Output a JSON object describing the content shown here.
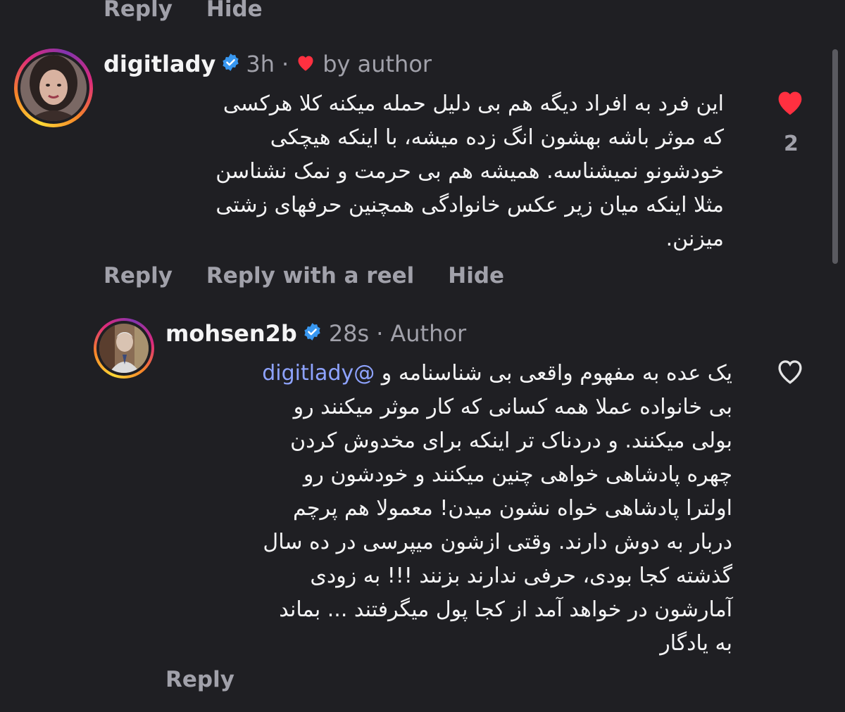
{
  "top_actions": {
    "reply": "Reply",
    "hide": "Hide"
  },
  "comment1": {
    "username": "digitlady",
    "time": "3h",
    "separator": "·",
    "liked_by": "by author",
    "text": "این فرد به افراد دیگه هم بی دلیل حمله میکنه کلا هرکسی\nکه موثر باشه بهشون انگ زده میشه، با اینکه هیچکی\nخودشونو نمیشناسه. همیشه هم بی حرمت و نمک نشناسن\nمثلا اینکه میان زیر عکس خانوادگی همچنین حرفهای زشتی\nمیزنن.",
    "like_count": "2",
    "actions": {
      "reply": "Reply",
      "reply_reel": "Reply with a reel",
      "hide": "Hide"
    }
  },
  "comment2": {
    "username": "mohsen2b",
    "time": "28s",
    "separator": "·",
    "author_label": "Author",
    "mention": "@digitlady",
    "text_first": "یک عده به مفهوم واقعی بی شناسنامه و",
    "text": "بی خانواده عملا همه کسانی که کار موثر میکنند رو\nبولی میکنند. و دردناک تر اینکه برای مخدوش کردن\nچهره پادشاهی خواهی چنین میکنند و خودشون رو\nاولترا پادشاهی خواه نشون میدن! معمولا هم پرچم\nدربار به دوش دارند. وقتی ازشون میپرسی در ده سال\nگذشته کجا بودی، حرفی ندارند بزنند !!! به زودی\nآمارشون در خواهد آمد از کجا پول میگرفتند ... بماند\nبه یادگار",
    "actions": {
      "reply": "Reply"
    }
  },
  "icons": {
    "verified": "verified-badge-icon",
    "heart_small": "heart-icon",
    "like_filled": "heart-filled-icon",
    "like_outline": "heart-outline-icon"
  },
  "colors": {
    "background": "#1f1f23",
    "text_primary": "#f4f4f5",
    "text_secondary": "#a1a1aa",
    "verified": "#3897f0",
    "like": "#ff3040",
    "mention": "#8ea3ff"
  }
}
